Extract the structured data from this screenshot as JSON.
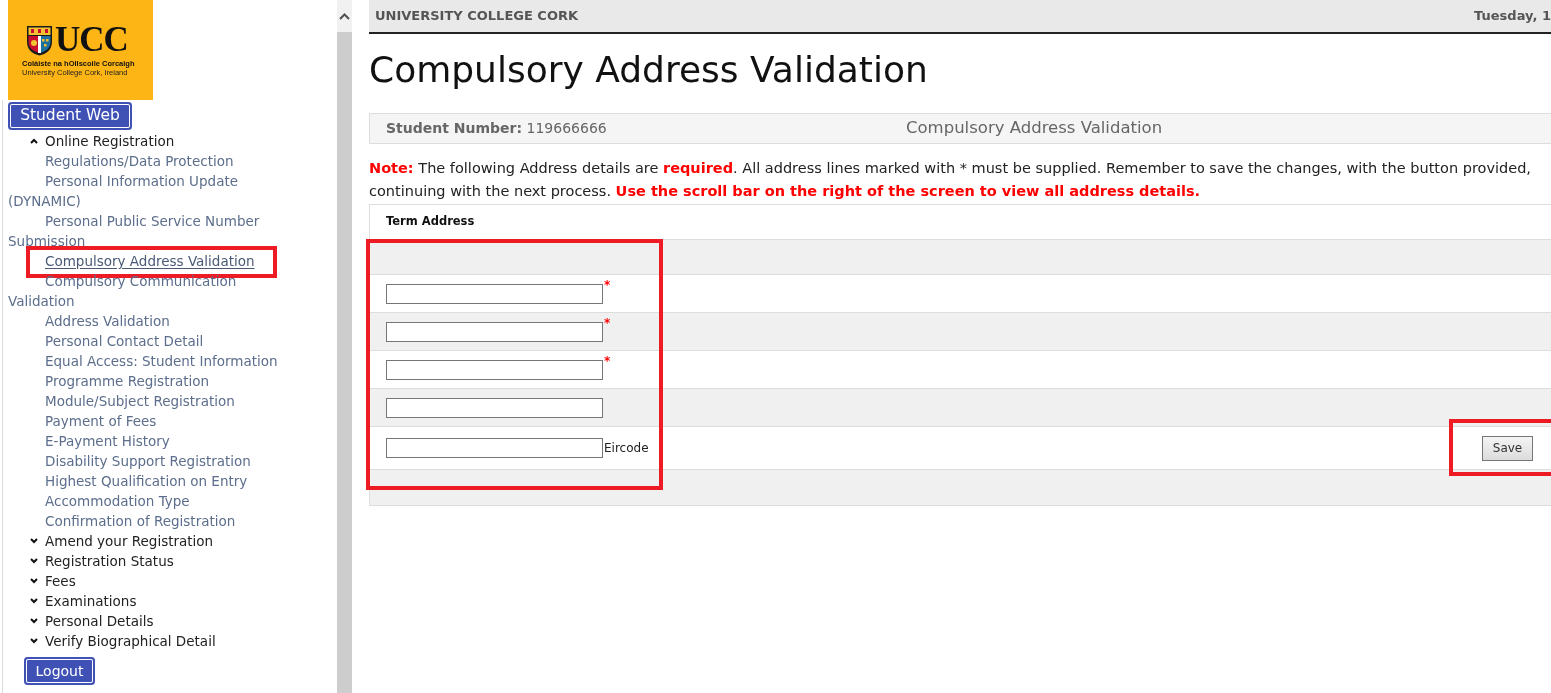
{
  "logo": {
    "wordmark": "UCC",
    "irish_name": "Coláiste na hOllscoile Corcaigh",
    "english_name": "University College Cork, Ireland"
  },
  "sidebar": {
    "title_button": "Student Web",
    "menu": [
      {
        "label": "Online Registration",
        "expanded": true,
        "children": [
          {
            "label": "Regulations/Data Protection",
            "selected": false
          },
          {
            "label": "Personal Information Update (DYNAMIC)",
            "selected": false
          },
          {
            "label": "Personal Public Service Number Submission",
            "selected": false
          },
          {
            "label": "Compulsory Address Validation",
            "selected": true
          },
          {
            "label": "Compulsory Communication Validation",
            "selected": false
          },
          {
            "label": "Address Validation",
            "selected": false
          },
          {
            "label": "Personal Contact Detail",
            "selected": false
          },
          {
            "label": "Equal Access: Student Information",
            "selected": false
          },
          {
            "label": "Programme Registration",
            "selected": false
          },
          {
            "label": "Module/Subject Registration",
            "selected": false
          },
          {
            "label": "Payment of Fees",
            "selected": false
          },
          {
            "label": "E-Payment History",
            "selected": false
          },
          {
            "label": "Disability Support Registration",
            "selected": false
          },
          {
            "label": "Highest Qualification on Entry",
            "selected": false
          },
          {
            "label": "Accommodation Type",
            "selected": false
          },
          {
            "label": "Confirmation of Registration",
            "selected": false
          }
        ]
      },
      {
        "label": "Amend your Registration",
        "expanded": false
      },
      {
        "label": "Registration Status",
        "expanded": false
      },
      {
        "label": "Fees",
        "expanded": false
      },
      {
        "label": "Examinations",
        "expanded": false
      },
      {
        "label": "Personal Details",
        "expanded": false
      },
      {
        "label": "Verify Biographical Detail",
        "expanded": false
      }
    ],
    "logout_button": "Logout"
  },
  "header": {
    "institution": "UNIVERSITY COLLEGE CORK",
    "date": "Tuesday, 1"
  },
  "page_title": "Compulsory Address Validation",
  "student_bar": {
    "label": "Student Number:",
    "value": "119666666",
    "section_title": "Compulsory Address Validation"
  },
  "notice": {
    "lines": [
      "**Note:** The following Address details are **required**. All address lines marked with * must be supplied. Remember to save the changes, with the button provided,",
      "continuing with the next process. **Use the scroll bar on the right of the screen to view all address details.**"
    ]
  },
  "address_form": {
    "heading": "Term Address",
    "lines": [
      {
        "kind": "required",
        "suffix": "*"
      },
      {
        "kind": "required",
        "suffix": "*"
      },
      {
        "kind": "required",
        "suffix": "*"
      },
      {
        "kind": "plain"
      },
      {
        "kind": "label",
        "suffix": "Eircode"
      }
    ],
    "save_button": "Save"
  }
}
